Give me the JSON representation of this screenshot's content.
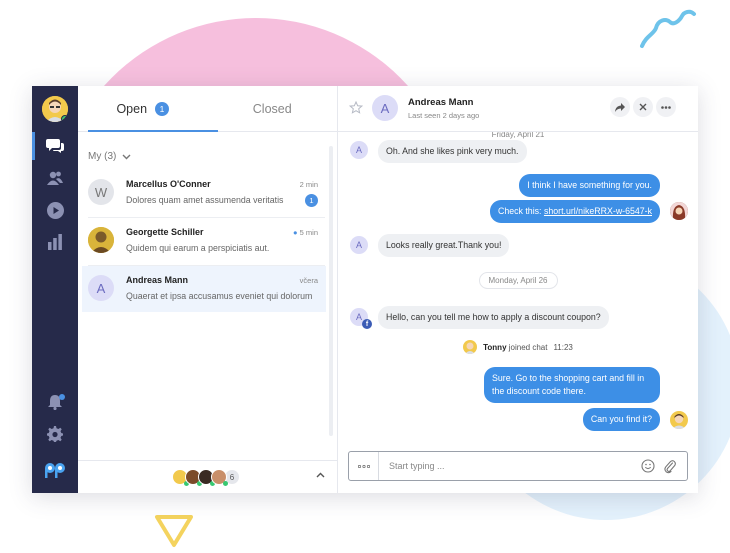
{
  "colors": {
    "accent": "#4a90e2",
    "rail": "#262a4a",
    "outgoing": "#3d8fe6",
    "online": "#37c871"
  },
  "rail": {
    "icons": [
      "chat-icon",
      "contacts-icon",
      "play-icon",
      "stats-icon",
      "bell-icon",
      "gear-icon",
      "logo-icon"
    ]
  },
  "tabs": {
    "open": "Open",
    "open_count": "1",
    "closed": "Closed"
  },
  "group": {
    "label": "My (3)"
  },
  "conversations": [
    {
      "avatar": "W",
      "name": "Marcellus O'Conner",
      "time": "2 min",
      "preview": "Dolores quam amet assumenda veritatis",
      "unread": "1"
    },
    {
      "avatar": "",
      "name": "Georgette Schiller",
      "time": "5 min",
      "preview": "Quidem qui earum a perspiciatis aut."
    },
    {
      "avatar": "A",
      "name": "Andreas Mann",
      "time": "včera",
      "preview": "Quaerat et ipsa accusamus eveniet qui dolorum"
    }
  ],
  "footer": {
    "more_count": "6"
  },
  "chat": {
    "avatar": "A",
    "name": "Andreas Mann",
    "seen": "Last seen 2 days ago",
    "messages": {
      "date1": "Friday, April 21",
      "m1": "Oh. And she likes pink very much.",
      "m2": "I think I have something for you.",
      "m3_prefix": "Check this: ",
      "m3_link": "short.url/nikeRRX-w-6547-k",
      "m4": "Looks really great.Thank you!",
      "date2": "Monday, April 26",
      "m5": "Hello, can you tell me how to apply a discount coupon?",
      "sys_name": "Tonny",
      "sys_text": "joined chat",
      "sys_time": "11:23",
      "m6": "Sure. Go to the shopping cart and fill in the discount code there.",
      "m7": "Can you find it?"
    },
    "composer": {
      "placeholder": "Start typing ...",
      "value": ""
    }
  }
}
